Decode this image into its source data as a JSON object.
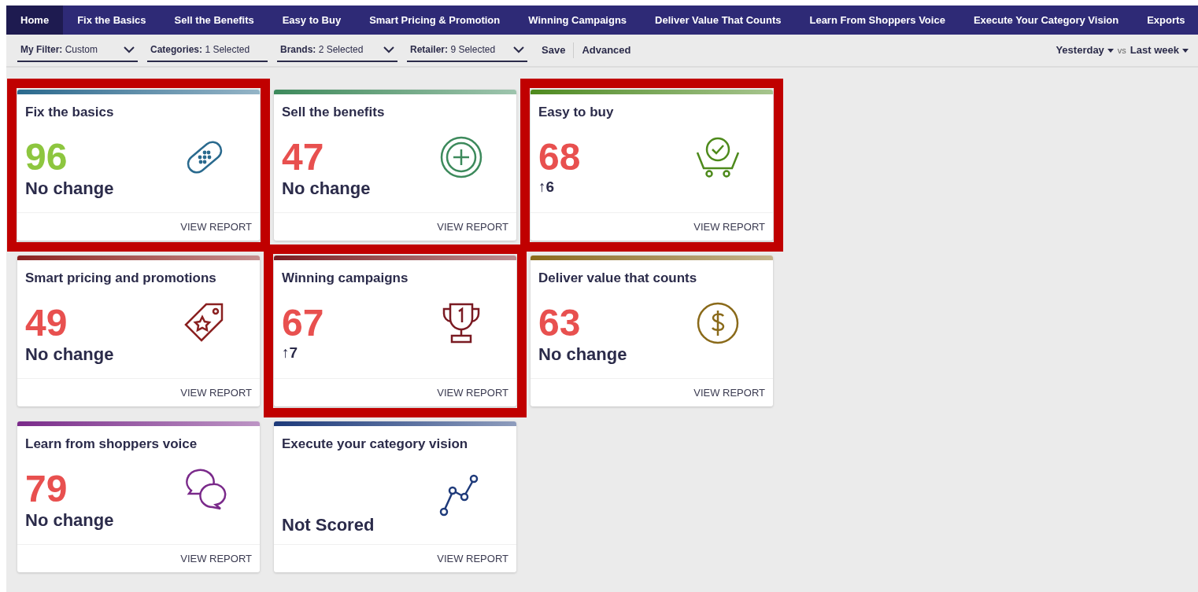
{
  "nav": [
    {
      "label": "Home",
      "selected": true
    },
    {
      "label": "Fix the Basics",
      "selected": false
    },
    {
      "label": "Sell the Benefits",
      "selected": false
    },
    {
      "label": "Easy to Buy",
      "selected": false
    },
    {
      "label": "Smart Pricing & Promotion",
      "selected": false
    },
    {
      "label": "Winning Campaigns",
      "selected": false
    },
    {
      "label": "Deliver Value That Counts",
      "selected": false
    },
    {
      "label": "Learn From Shoppers Voice",
      "selected": false
    },
    {
      "label": "Execute Your Category Vision",
      "selected": false
    },
    {
      "label": "Exports",
      "selected": false
    }
  ],
  "filters": [
    {
      "label": "My Filter:",
      "value": "Custom",
      "dropdown": true
    },
    {
      "label": "Categories:",
      "value": "1 Selected",
      "dropdown": false
    },
    {
      "label": "Brands:",
      "value": "2 Selected",
      "dropdown": true
    },
    {
      "label": "Retailer:",
      "value": "9 Selected",
      "dropdown": true
    }
  ],
  "actions": [
    "Save",
    "Advanced"
  ],
  "period": {
    "current": "Yesterday",
    "vs": "vs",
    "compare": "Last week"
  },
  "cards": [
    {
      "title": "Fix the basics",
      "score": "96",
      "score_good": true,
      "change": "No change",
      "improved": false,
      "link": "VIEW REPORT",
      "highlighted": true,
      "color": "#2a6a8e"
    },
    {
      "title": "Sell the benefits",
      "score": "47",
      "score_good": false,
      "change": "No change",
      "improved": false,
      "link": "VIEW REPORT",
      "highlighted": false,
      "color": "#3d8a5c"
    },
    {
      "title": "Easy to buy",
      "score": "68",
      "score_good": false,
      "change": "↑6",
      "improved": true,
      "link": "VIEW REPORT",
      "highlighted": true,
      "color": "#4e8a1c"
    },
    {
      "title": "Smart pricing and promotions",
      "score": "49",
      "score_good": false,
      "change": "No change",
      "improved": false,
      "link": "VIEW REPORT",
      "highlighted": false,
      "color": "#8a2020"
    },
    {
      "title": "Winning campaigns",
      "score": "67",
      "score_good": false,
      "change": "↑7",
      "improved": true,
      "link": "VIEW REPORT",
      "highlighted": true,
      "color": "#7a1a22"
    },
    {
      "title": "Deliver value that counts",
      "score": "63",
      "score_good": false,
      "change": "No change",
      "improved": false,
      "link": "VIEW REPORT",
      "highlighted": false,
      "color": "#8a6a1a"
    },
    {
      "title": "Learn from shoppers voice",
      "score": "79",
      "score_good": false,
      "change": "No change",
      "improved": false,
      "link": "VIEW REPORT",
      "highlighted": false,
      "color": "#7a2a8a"
    },
    {
      "title": "Execute your category vision",
      "change": "Not Scored",
      "improved": false,
      "link": "VIEW REPORT",
      "highlighted": false,
      "color": "#1e3a7a"
    }
  ]
}
